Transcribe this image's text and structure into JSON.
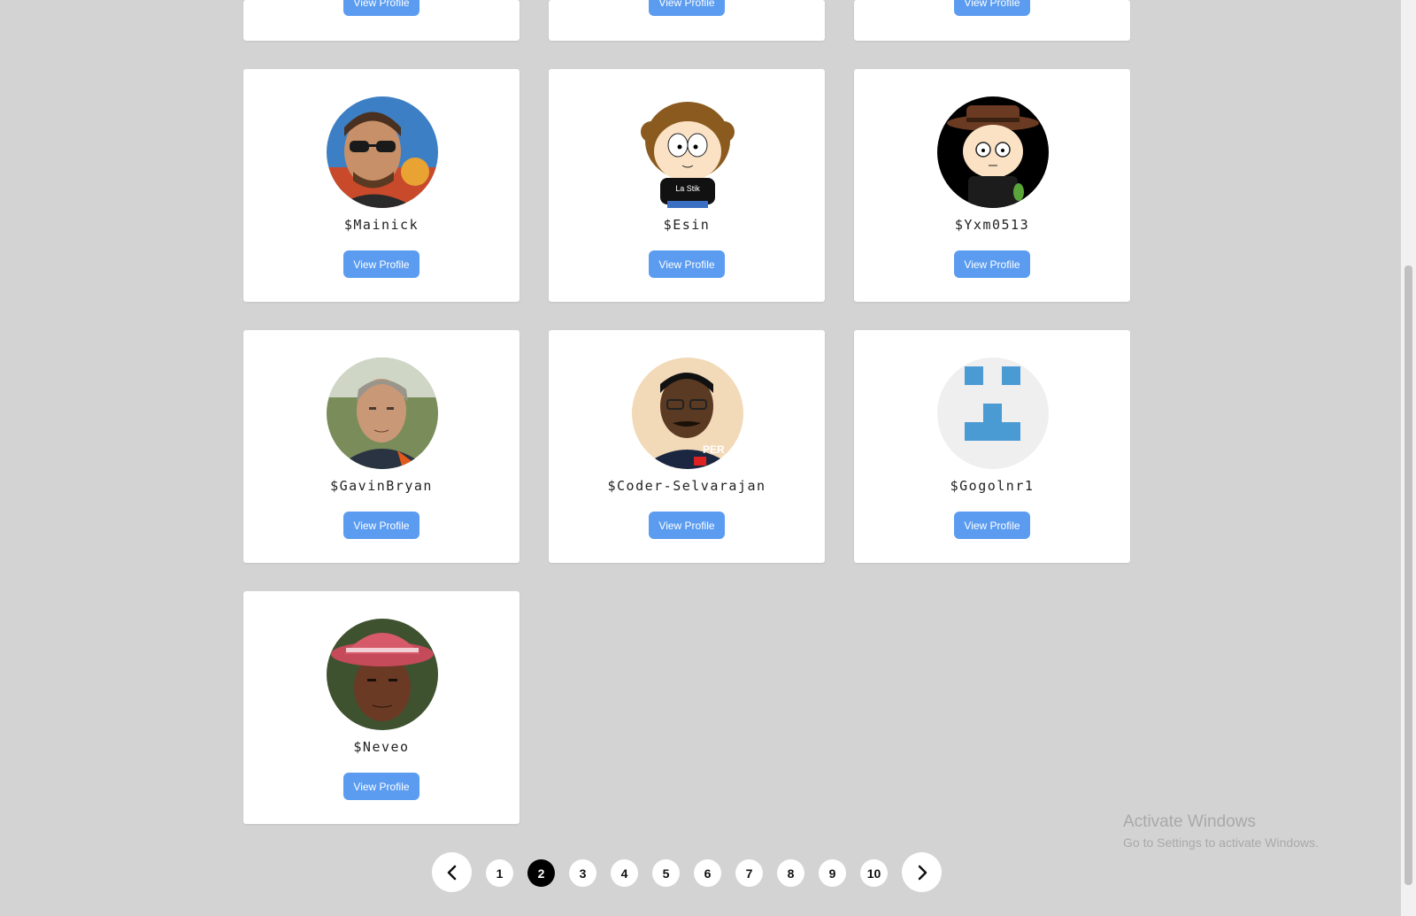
{
  "partial_cards": [
    {
      "button_label": "View Profile"
    },
    {
      "button_label": "View Profile"
    },
    {
      "button_label": "View Profile"
    }
  ],
  "cards": [
    {
      "username": "$Mainick",
      "button_label": "View Profile",
      "avatar": "photo-sunglasses-avatar"
    },
    {
      "username": "$Esin",
      "button_label": "View Profile",
      "avatar": "cartoon-curly-hair-avatar"
    },
    {
      "username": "$Yxm0513",
      "button_label": "View Profile",
      "avatar": "cartoon-hat-glasses-avatar"
    },
    {
      "username": "$GavinBryan",
      "button_label": "View Profile",
      "avatar": "photo-grey-hair-avatar"
    },
    {
      "username": "$Coder-Selvarajan",
      "button_label": "View Profile",
      "avatar": "photo-glasses-avatar"
    },
    {
      "username": "$Gogolnr1",
      "button_label": "View Profile",
      "avatar": "identicon-avatar"
    },
    {
      "username": "$Neveo",
      "button_label": "View Profile",
      "avatar": "photo-pink-hat-avatar"
    }
  ],
  "pagination": {
    "pages": [
      "1",
      "2",
      "3",
      "4",
      "5",
      "6",
      "7",
      "8",
      "9",
      "10"
    ],
    "active": "2",
    "prev_icon": "chevron-left-icon",
    "next_icon": "chevron-right-icon"
  },
  "watermark": {
    "title": "Activate Windows",
    "subtitle": "Go to Settings to activate Windows."
  },
  "colors": {
    "background": "#d3d3d3",
    "button": "#5b9cf0",
    "active_page": "#000000"
  }
}
